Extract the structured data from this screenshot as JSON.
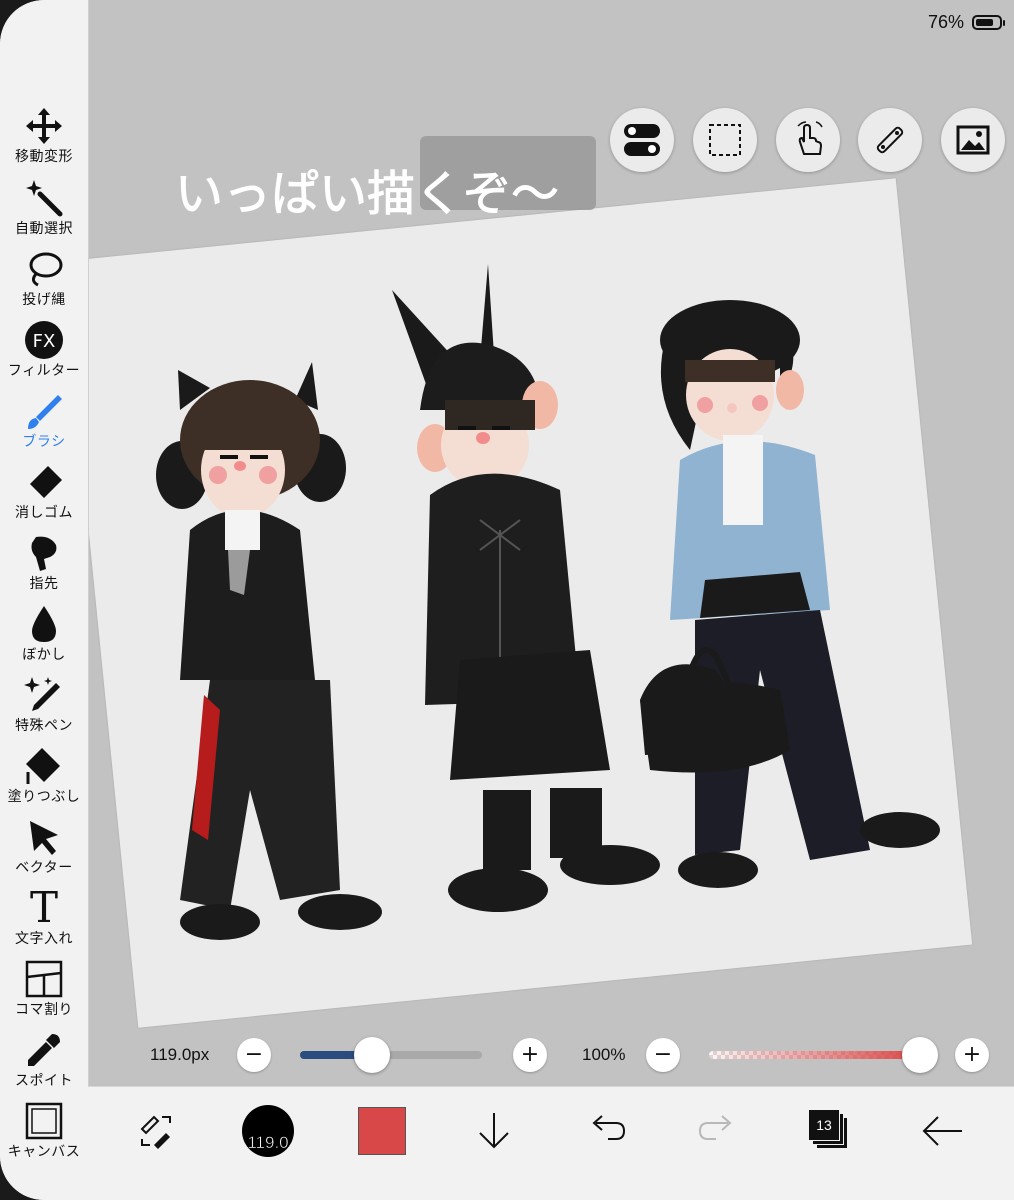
{
  "status": {
    "battery_percent": "76%"
  },
  "toolbar": {
    "items": [
      {
        "label": "移動変形",
        "icon": "move-icon"
      },
      {
        "label": "自動選択",
        "icon": "magic-wand-icon"
      },
      {
        "label": "投げ縄",
        "icon": "lasso-icon"
      },
      {
        "label": "フィルター",
        "icon": "fx-icon",
        "badge": "FX"
      },
      {
        "label": "ブラシ",
        "icon": "brush-icon",
        "active": true
      },
      {
        "label": "消しゴム",
        "icon": "eraser-icon"
      },
      {
        "label": "指先",
        "icon": "finger-icon"
      },
      {
        "label": "ぼかし",
        "icon": "blur-drop-icon"
      },
      {
        "label": "特殊ペン",
        "icon": "special-pen-icon"
      },
      {
        "label": "塗りつぶし",
        "icon": "fill-bucket-icon"
      },
      {
        "label": "ベクター",
        "icon": "vector-arrow-icon"
      },
      {
        "label": "文字入れ",
        "icon": "text-icon",
        "glyph": "T"
      },
      {
        "label": "コマ割り",
        "icon": "panel-layout-icon"
      },
      {
        "label": "スポイト",
        "icon": "eyedropper-icon"
      },
      {
        "label": "キャンバス",
        "icon": "canvas-icon"
      }
    ]
  },
  "top_buttons": [
    "toggle-switch-icon",
    "selection-rect-icon",
    "touch-gesture-icon",
    "ruler-icon",
    "image-icon"
  ],
  "canvas": {
    "handwritten_text": "いっぱい描くぞ〜"
  },
  "sliders": {
    "brush_size": {
      "value_label": "119.0px",
      "fraction": 0.4
    },
    "opacity": {
      "value_label": "100%",
      "fraction": 1.0
    },
    "minus": "−",
    "plus": "+"
  },
  "bottom_bar": {
    "brush_size_preview": "119.0",
    "current_color": "#d94848",
    "layers_count": "13"
  },
  "colors": {
    "accent": "#2f80ed",
    "slider_fill": "#2b4c7e",
    "sidebar_bg": "#f2f2f2",
    "workspace_bg": "#c2c2c2"
  }
}
